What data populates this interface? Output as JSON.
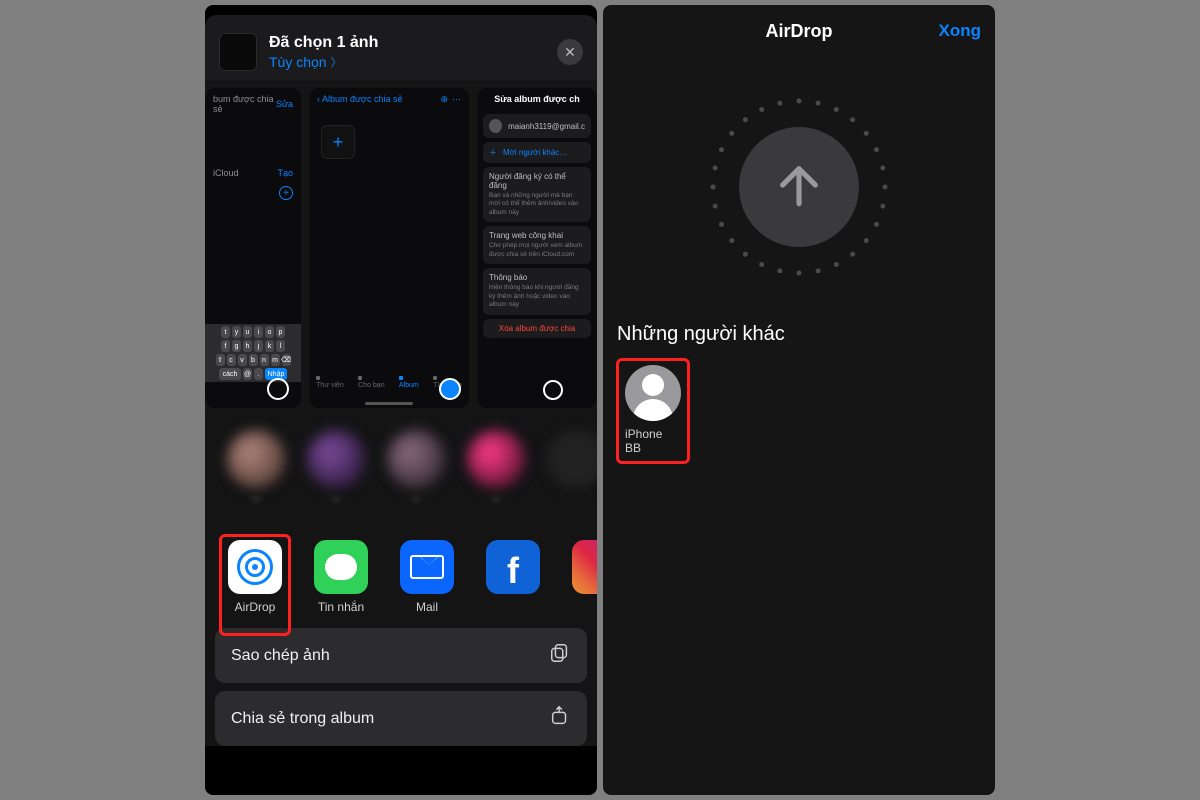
{
  "left": {
    "header": {
      "title": "Đã chọn 1 ảnh",
      "options_label": "Tùy chọn",
      "close_icon": "✕"
    },
    "shots": {
      "s1": {
        "section_header": "bum được chia sẻ",
        "edit_label": "Sửa",
        "icloud_label": "iCloud",
        "create_label": "Tạo",
        "key_r1": [
          "t",
          "y",
          "u",
          "i",
          "o",
          "p"
        ],
        "key_r2": [
          "f",
          "g",
          "h",
          "j",
          "k",
          "l"
        ],
        "key_r3": [
          "c",
          "v",
          "b",
          "n",
          "m"
        ],
        "space_label": "cách",
        "return_label": "Nhập"
      },
      "s2": {
        "back_label": "Album được chia sẻ",
        "tabs": [
          "Thư viện",
          "Cho bạn",
          "Album",
          "Tìm kiếm"
        ]
      },
      "s3": {
        "title": "Sửa album được ch",
        "email": "maianh3119@gmail.c",
        "invite_label": "Mời người khác…",
        "c1_title": "Người đăng ký có thể đăng",
        "c1_sub": "Bạn và những người mà bạn mời có thể thêm ảnh/video vào album này",
        "c2_title": "Trang web công khai",
        "c2_sub": "Cho phép mọi người xem album được chia sẻ trên iCloud.com",
        "c3_title": "Thông báo",
        "c3_sub": "Hiện thông báo khi người đăng ký thêm ảnh hoặc video vào album này",
        "c4_del": "Xóa album được chia"
      }
    },
    "apps": {
      "airdrop": "AirDrop",
      "messages": "Tin nhắn",
      "mail": "Mail",
      "facebook": "",
      "instagram": ""
    },
    "actions": {
      "copy": "Sao chép ảnh",
      "share_album": "Chia sẻ trong album"
    }
  },
  "right": {
    "title": "AirDrop",
    "done_label": "Xong",
    "section": "Những người khác",
    "target_name": "iPhone BB"
  }
}
